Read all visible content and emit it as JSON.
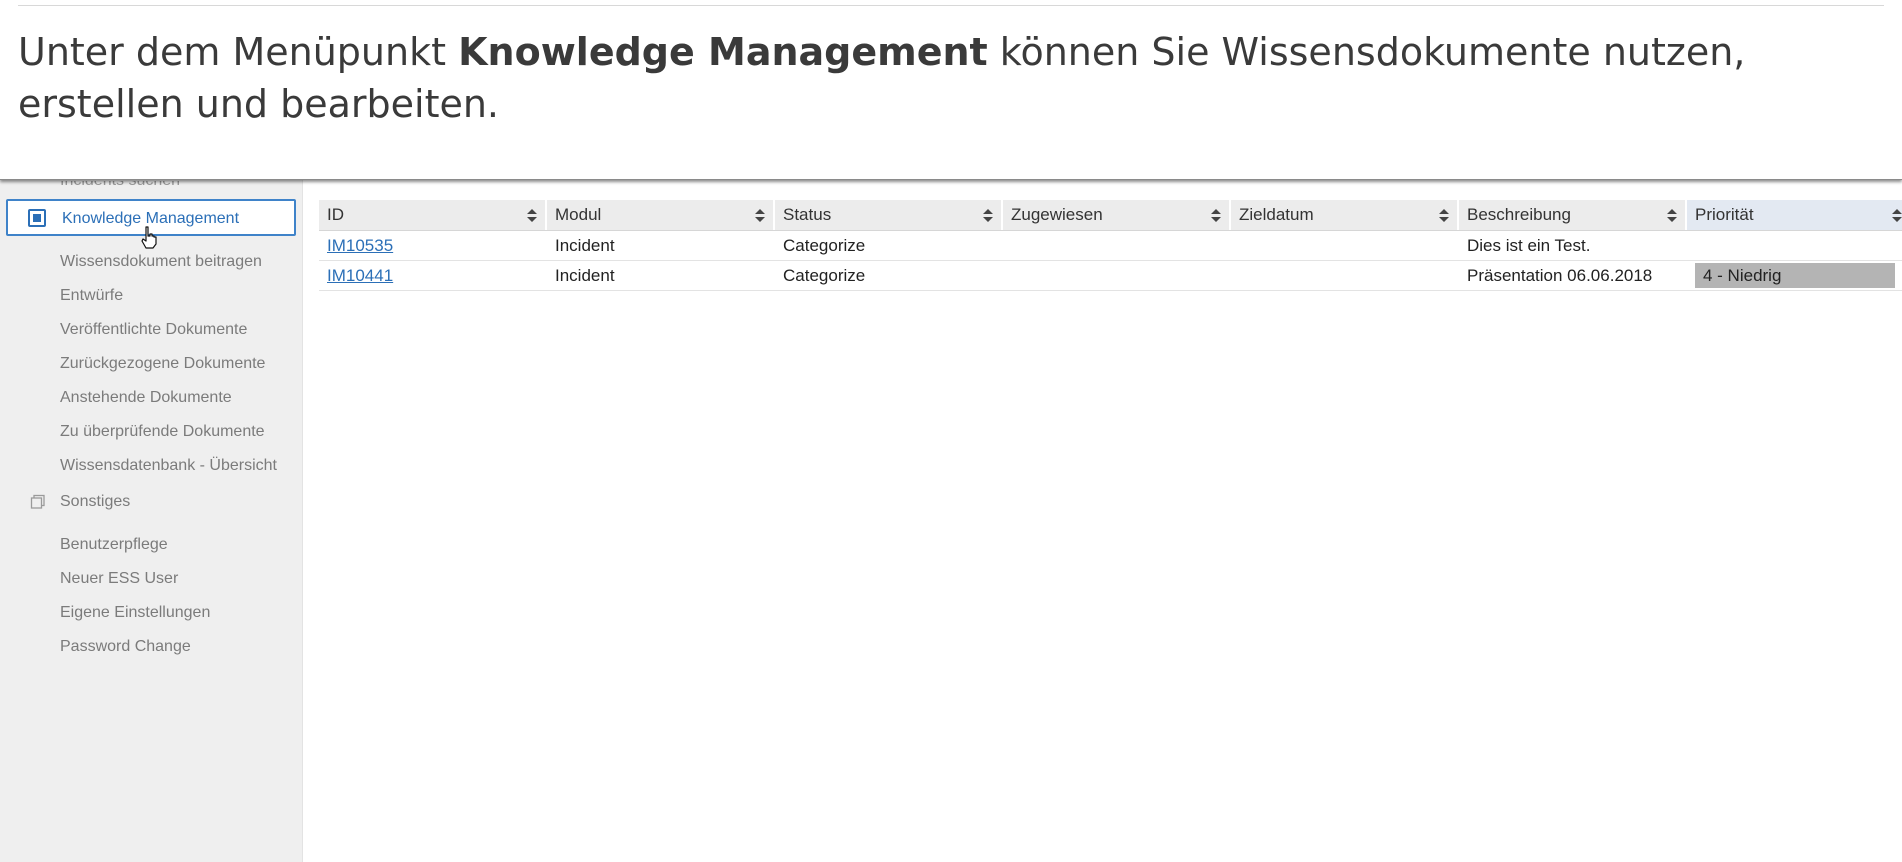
{
  "caption": {
    "before": "Unter dem Menüpunkt ",
    "bold": "Knowledge Management",
    "after": " können Sie Wissensdokumente nutzen, erstellen und bearbeiten."
  },
  "sidebar": {
    "cut_item": "Incidents suchen",
    "active": {
      "label": "Knowledge Management",
      "icon": "knowledge-management-icon"
    },
    "items": [
      "Wissensdokument beitragen",
      "Entwürfe",
      "Veröffentlichte Dokumente",
      "Zurückgezogene Dokumente",
      "Anstehende Dokumente",
      "Zu überprüfende Dokumente",
      "Wissensdatenbank - Übersicht"
    ],
    "group": {
      "label": "Sonstiges",
      "icon": "copy-icon"
    },
    "group_items": [
      "Benutzerpflege",
      "Neuer ESS User",
      "Eigene Einstellungen",
      "Password Change"
    ]
  },
  "table": {
    "columns": [
      "ID",
      "Modul",
      "Status",
      "Zugewiesen",
      "Zieldatum",
      "Beschreibung",
      "Priorität"
    ],
    "rows": [
      {
        "id": "IM10535",
        "modul": "Incident",
        "status": "Categorize",
        "zugewiesen": "",
        "zieldatum": "",
        "beschreibung": "Dies ist ein Test.",
        "prioritaet": ""
      },
      {
        "id": "IM10441",
        "modul": "Incident",
        "status": "Categorize",
        "zugewiesen": "",
        "zieldatum": "",
        "beschreibung": "Präsentation 06.06.2018",
        "prioritaet": "4 - Niedrig"
      }
    ]
  },
  "colors": {
    "accent": "#2b6fb7",
    "sidebar_bg": "#efefef",
    "header_bg": "#ececec",
    "priority_badge": "#b4b4b4"
  }
}
